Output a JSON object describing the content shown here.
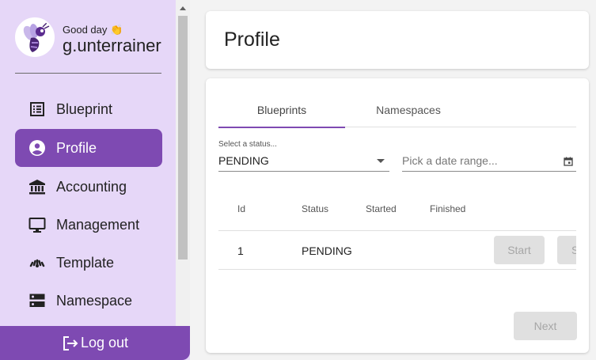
{
  "user": {
    "greeting": "Good day 👏",
    "username": "g.unterrainer"
  },
  "nav": {
    "items": [
      {
        "label": "Blueprint",
        "icon": "list-alt-icon"
      },
      {
        "label": "Profile",
        "icon": "account-circle-icon",
        "active": true
      },
      {
        "label": "Accounting",
        "icon": "bank-icon"
      },
      {
        "label": "Management",
        "icon": "monitor-icon"
      },
      {
        "label": "Template",
        "icon": "dashboard-gauge-icon"
      },
      {
        "label": "Namespace",
        "icon": "dns-icon"
      }
    ],
    "logout_label": "Log out"
  },
  "header": {
    "title": "Profile"
  },
  "tabs": [
    {
      "label": "Blueprints",
      "active": true
    },
    {
      "label": "Namespaces",
      "active": false
    }
  ],
  "filters": {
    "status_label": "Select a status...",
    "status_value": "PENDING",
    "date_placeholder": "Pick a date range..."
  },
  "table": {
    "columns": [
      "Id",
      "Status",
      "Started",
      "Finished"
    ],
    "rows": [
      {
        "id": "1",
        "status": "PENDING",
        "started": "",
        "finished": "",
        "actions": [
          "Start",
          "S"
        ]
      }
    ]
  },
  "pagination": {
    "next_label": "Next"
  },
  "colors": {
    "accent": "#7e4ab2",
    "sidebar_bg": "#e6d7f8",
    "disabled_bg": "#e0e0e0"
  }
}
